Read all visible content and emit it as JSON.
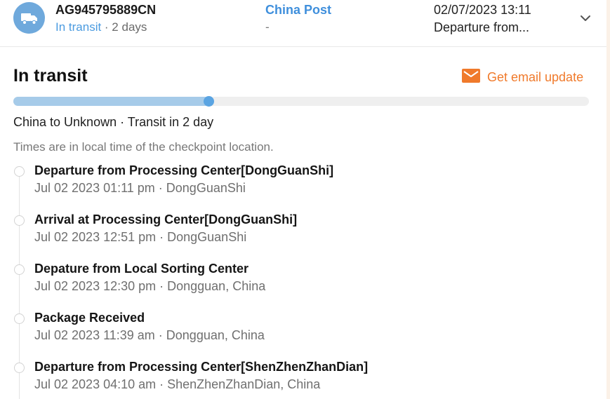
{
  "header": {
    "icon": "truck-icon",
    "tracking_number": "AG945795889CN",
    "status": "In transit",
    "status_suffix": " · 2 days",
    "carrier": "China Post",
    "carrier_sub": "-",
    "latest_time": "02/07/2023 13:11",
    "latest_event": "Departure from..."
  },
  "detail": {
    "title": "In transit",
    "email_update_label": "Get email update",
    "progress": 0.34,
    "route": "China to Unknown · Transit in 2 day",
    "timezone_note": "Times are in local time of the checkpoint location."
  },
  "colors": {
    "status": "#4b9be0",
    "carrier": "#3f8fdc",
    "accent": "#f07a2b",
    "progress_fill": "#a6cbe9",
    "progress_knob": "#5aa4e2"
  },
  "events": [
    {
      "title": "Departure from Processing Center[DongGuanShi]",
      "meta": "Jul 02 2023 01:11 pm · DongGuanShi"
    },
    {
      "title": "Arrival at Processing Center[DongGuanShi]",
      "meta": "Jul 02 2023 12:51 pm · DongGuanShi"
    },
    {
      "title": "Depature from Local Sorting Center",
      "meta": "Jul 02 2023 12:30 pm · Dongguan, China"
    },
    {
      "title": "Package Received",
      "meta": "Jul 02 2023 11:39 am · Dongguan, China"
    },
    {
      "title": "Departure from Processing Center[ShenZhenZhanDian]",
      "meta": "Jul 02 2023 04:10 am · ShenZhenZhanDian, China"
    }
  ]
}
